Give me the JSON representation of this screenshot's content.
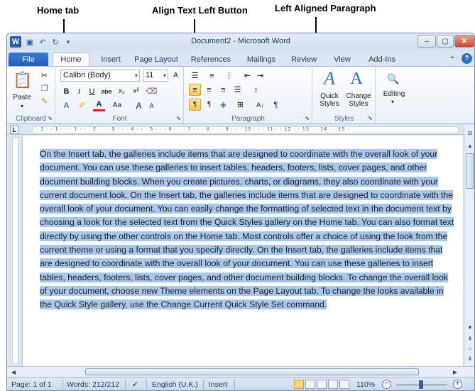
{
  "annotations": {
    "home_tab": "Home tab",
    "align_left": "Align Text Left Button",
    "left_aligned": "Left Aligned Paragraph"
  },
  "titlebar": {
    "title": "Document2 - Microsoft Word",
    "minimize": "–",
    "maximize": "▢",
    "close": "✕"
  },
  "tabs": {
    "file": "File",
    "home": "Home",
    "insert": "Insert",
    "page_layout": "Page Layout",
    "references": "References",
    "mailings": "Mailings",
    "review": "Review",
    "view": "View",
    "addins": "Add-Ins"
  },
  "ribbon": {
    "clipboard": {
      "label": "Clipboard",
      "paste": "Paste"
    },
    "font": {
      "label": "Font",
      "font_name": "Calibri (Body)",
      "font_size": "11",
      "bold": "B",
      "italic": "I",
      "underline": "U",
      "strike": "abe",
      "subscript": "x₂",
      "superscript": "x²",
      "text_effects": "A",
      "font_color": "A",
      "change_case": "Aa",
      "grow": "A",
      "shrink": "A"
    },
    "paragraph": {
      "label": "Paragraph",
      "show_hide": "¶",
      "sort": "A↓"
    },
    "styles": {
      "label": "Styles",
      "quick_styles": "Quick Styles",
      "change_styles": "Change Styles"
    },
    "editing": {
      "label": "Editing"
    }
  },
  "document": {
    "paragraph_text": "On the Insert tab, the galleries include items that are designed to coordinate with the overall look of your document. You can use these galleries to insert tables, headers, footers, lists, cover pages, and other document building blocks. When you create pictures, charts, or diagrams, they also coordinate with your current document look. On the Insert tab, the galleries include items that are designed to coordinate with the overall look of your document. You can easily change the formatting of selected text in the document text by choosing a look for the selected text from the Quick Styles gallery on the Home tab. You can also format text directly by using the other controls on the Home tab. Most controls offer a choice of using the look from the current theme or using a format that you specify directly. On the Insert tab, the galleries include items that are designed to coordinate with the overall look of your document. You can use these galleries to insert tables, headers, footers, lists, cover pages, and other document building blocks. To change the overall look of your document, choose new Theme elements on the Page Layout tab. To change the looks available in the Quick Style gallery, use the Change Current Quick Style Set command.",
    "alignment": "left",
    "selected": true
  },
  "ruler": {
    "marks": "· 1 · · 1 · · · 1 · · · 2 · · · 3 · · · 4 · · · 5 · · · 6 · · · 7 · · · 8 · · · 9 · · · 10 · · · 11 · · 12 · · 13 · · 14 · · 15 ·"
  },
  "statusbar": {
    "page": "Page: 1 of 1",
    "words": "Words: 212/212",
    "language": "English (U.K.)",
    "mode": "Insert",
    "zoom": "110%",
    "zoom_minus": "−",
    "zoom_plus": "+"
  },
  "colors": {
    "selection": "#a8c7ec",
    "file_tab": "#2f6bc4",
    "ribbon_bg": "#e9f0f9",
    "frame": "#dbe6f4"
  }
}
